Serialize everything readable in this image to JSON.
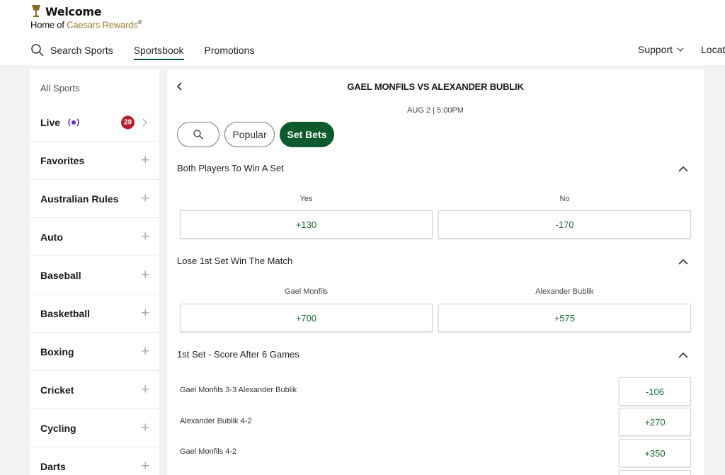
{
  "header": {
    "welcome": "Welcome",
    "home_of": "Home of ",
    "caesars_rewards": "Caesars Rewards",
    "registered": "®"
  },
  "nav": {
    "search": "Search Sports",
    "sportsbook": "Sportsbook",
    "promotions": "Promotions",
    "support": "Support",
    "location": "Locatio"
  },
  "sidebar": {
    "all_sports": "All Sports",
    "live": {
      "label": "Live",
      "count": "29"
    },
    "items": [
      {
        "label": "Favorites"
      },
      {
        "label": "Australian Rules"
      },
      {
        "label": "Auto"
      },
      {
        "label": "Baseball"
      },
      {
        "label": "Basketball"
      },
      {
        "label": "Boxing"
      },
      {
        "label": "Cricket"
      },
      {
        "label": "Cycling"
      },
      {
        "label": "Darts"
      }
    ]
  },
  "event": {
    "title": "GAEL MONFILS VS ALEXANDER BUBLIK",
    "date": "AUG 2 | 5:00PM"
  },
  "filters": {
    "popular": "Popular",
    "set_bets": "Set Bets"
  },
  "markets": {
    "both_win_set": {
      "title": "Both Players To Win A Set",
      "options": [
        {
          "label": "Yes",
          "odds": "+130"
        },
        {
          "label": "No",
          "odds": "-170"
        }
      ]
    },
    "lose_first_win_match": {
      "title": "Lose 1st Set Win The Match",
      "options": [
        {
          "label": "Gael Monfils",
          "odds": "+700"
        },
        {
          "label": "Alexander Bublik",
          "odds": "+575"
        }
      ]
    },
    "score_after_6": {
      "title": "1st Set - Score After 6 Games",
      "rows": [
        {
          "label": "Gael Monfils 3-3 Alexander Bublik",
          "odds": "-106"
        },
        {
          "label": "Alexander Bublik 4-2",
          "odds": "+270"
        },
        {
          "label": "Gael Monfils 4-2",
          "odds": "+350"
        }
      ]
    }
  },
  "colors": {
    "brand_green": "#0c5a2e",
    "odds_green": "#1a6b32",
    "live_badge": "#b8202e",
    "gold": "#9a7b2c"
  }
}
